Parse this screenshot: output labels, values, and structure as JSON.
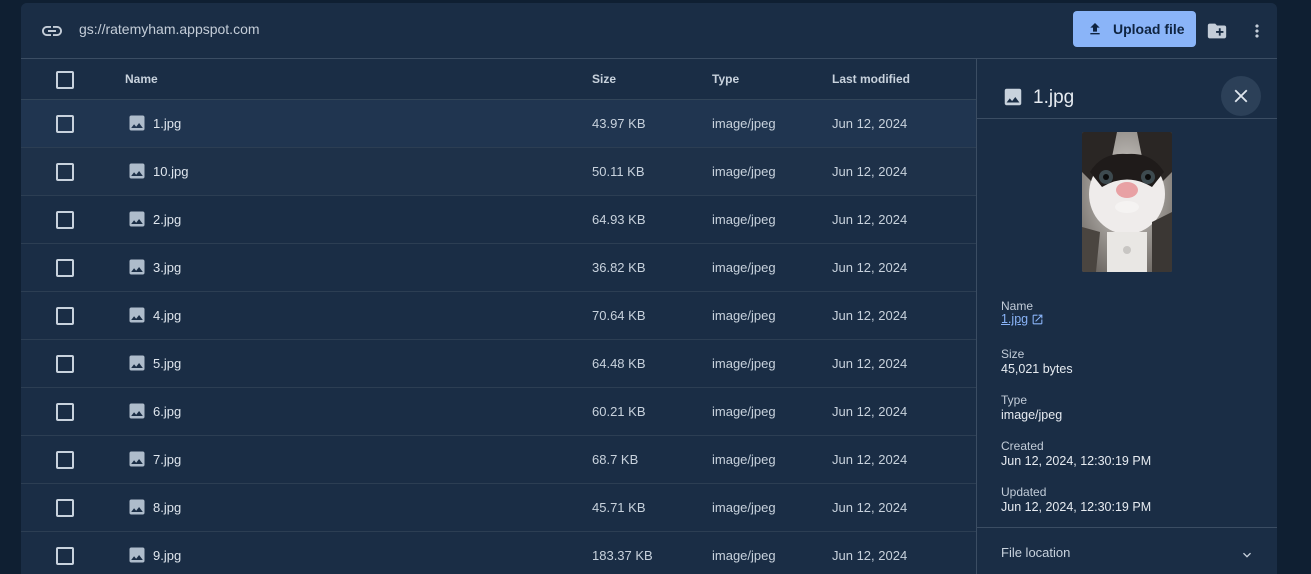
{
  "header": {
    "bucket_path": "gs://ratemyham.appspot.com",
    "upload_label": "Upload file",
    "icons": [
      "link-icon",
      "upload-icon",
      "create-folder-icon",
      "more-vert-icon"
    ]
  },
  "table": {
    "columns": {
      "name": "Name",
      "size": "Size",
      "type": "Type",
      "modified": "Last modified"
    },
    "rows": [
      {
        "name": "1.jpg",
        "size": "43.97 KB",
        "type": "image/jpeg",
        "modified": "Jun 12, 2024"
      },
      {
        "name": "10.jpg",
        "size": "50.11 KB",
        "type": "image/jpeg",
        "modified": "Jun 12, 2024"
      },
      {
        "name": "2.jpg",
        "size": "64.93 KB",
        "type": "image/jpeg",
        "modified": "Jun 12, 2024"
      },
      {
        "name": "3.jpg",
        "size": "36.82 KB",
        "type": "image/jpeg",
        "modified": "Jun 12, 2024"
      },
      {
        "name": "4.jpg",
        "size": "70.64 KB",
        "type": "image/jpeg",
        "modified": "Jun 12, 2024"
      },
      {
        "name": "5.jpg",
        "size": "64.48 KB",
        "type": "image/jpeg",
        "modified": "Jun 12, 2024"
      },
      {
        "name": "6.jpg",
        "size": "60.21 KB",
        "type": "image/jpeg",
        "modified": "Jun 12, 2024"
      },
      {
        "name": "7.jpg",
        "size": "68.7 KB",
        "type": "image/jpeg",
        "modified": "Jun 12, 2024"
      },
      {
        "name": "8.jpg",
        "size": "45.71 KB",
        "type": "image/jpeg",
        "modified": "Jun 12, 2024"
      },
      {
        "name": "9.jpg",
        "size": "183.37 KB",
        "type": "image/jpeg",
        "modified": "Jun 12, 2024"
      }
    ]
  },
  "details": {
    "title": "1.jpg",
    "name_label": "Name",
    "name_value": "1.jpg",
    "size_label": "Size",
    "size_value": "45,021 bytes",
    "type_label": "Type",
    "type_value": "image/jpeg",
    "created_label": "Created",
    "created_value": "Jun 12, 2024, 12:30:19 PM",
    "updated_label": "Updated",
    "updated_value": "Jun 12, 2024, 12:30:19 PM",
    "file_location_label": "File location"
  },
  "colors": {
    "background": "#0f1f32",
    "surface": "#1a2d45",
    "accent": "#8ab4f8",
    "selected_row": "#203550"
  }
}
